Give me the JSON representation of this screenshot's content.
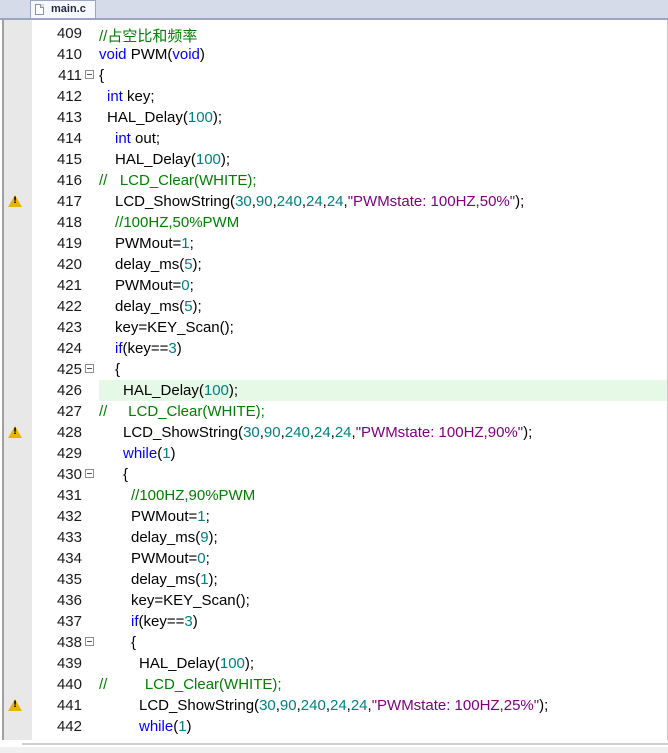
{
  "tab": {
    "label": "main.c",
    "icon": "c-file-icon"
  },
  "lines": [
    {
      "n": "409",
      "indent": 0,
      "segs": [
        {
          "t": "//占空比和频率",
          "c": "cm"
        }
      ]
    },
    {
      "n": "410",
      "indent": 0,
      "segs": [
        {
          "t": "void",
          "c": "kw"
        },
        {
          "t": " PWM(",
          "c": ""
        },
        {
          "t": "void",
          "c": "kw"
        },
        {
          "t": ")",
          "c": ""
        }
      ]
    },
    {
      "n": "411",
      "indent": 0,
      "fold": true,
      "segs": [
        {
          "t": "{",
          "c": ""
        }
      ]
    },
    {
      "n": "412",
      "indent": 1,
      "segs": [
        {
          "t": "int",
          "c": "kw"
        },
        {
          "t": " key;",
          "c": ""
        }
      ]
    },
    {
      "n": "413",
      "indent": 1,
      "segs": [
        {
          "t": "HAL_Delay(",
          "c": ""
        },
        {
          "t": "100",
          "c": "num"
        },
        {
          "t": ");",
          "c": ""
        }
      ]
    },
    {
      "n": "414",
      "indent": 2,
      "segs": [
        {
          "t": "int",
          "c": "kw"
        },
        {
          "t": " out;",
          "c": ""
        }
      ]
    },
    {
      "n": "415",
      "indent": 2,
      "segs": [
        {
          "t": "HAL_Delay(",
          "c": ""
        },
        {
          "t": "100",
          "c": "num"
        },
        {
          "t": ");",
          "c": ""
        }
      ]
    },
    {
      "n": "416",
      "indent": 0,
      "segs": [
        {
          "t": "//   LCD_Clear(WHITE);",
          "c": "cm"
        }
      ]
    },
    {
      "n": "417",
      "indent": 2,
      "warn": true,
      "segs": [
        {
          "t": "LCD_ShowString(",
          "c": ""
        },
        {
          "t": "30",
          "c": "num"
        },
        {
          "t": ",",
          "c": ""
        },
        {
          "t": "90",
          "c": "num"
        },
        {
          "t": ",",
          "c": ""
        },
        {
          "t": "240",
          "c": "num"
        },
        {
          "t": ",",
          "c": ""
        },
        {
          "t": "24",
          "c": "num"
        },
        {
          "t": ",",
          "c": ""
        },
        {
          "t": "24",
          "c": "num"
        },
        {
          "t": ",",
          "c": ""
        },
        {
          "t": "\"PWMstate: 100HZ,50%\"",
          "c": "str"
        },
        {
          "t": ");",
          "c": ""
        }
      ]
    },
    {
      "n": "418",
      "indent": 2,
      "segs": [
        {
          "t": "//100HZ,50%PWM",
          "c": "cm"
        }
      ]
    },
    {
      "n": "419",
      "indent": 2,
      "segs": [
        {
          "t": "PWMout=",
          "c": ""
        },
        {
          "t": "1",
          "c": "num"
        },
        {
          "t": ";",
          "c": ""
        }
      ]
    },
    {
      "n": "420",
      "indent": 2,
      "segs": [
        {
          "t": "delay_ms(",
          "c": ""
        },
        {
          "t": "5",
          "c": "num"
        },
        {
          "t": ");",
          "c": ""
        }
      ]
    },
    {
      "n": "421",
      "indent": 2,
      "segs": [
        {
          "t": "PWMout=",
          "c": ""
        },
        {
          "t": "0",
          "c": "num"
        },
        {
          "t": ";",
          "c": ""
        }
      ]
    },
    {
      "n": "422",
      "indent": 2,
      "segs": [
        {
          "t": "delay_ms(",
          "c": ""
        },
        {
          "t": "5",
          "c": "num"
        },
        {
          "t": ");",
          "c": ""
        }
      ]
    },
    {
      "n": "423",
      "indent": 2,
      "segs": [
        {
          "t": "key=KEY_Scan();",
          "c": ""
        }
      ]
    },
    {
      "n": "424",
      "indent": 2,
      "segs": [
        {
          "t": "if",
          "c": "kw"
        },
        {
          "t": "(key==",
          "c": ""
        },
        {
          "t": "3",
          "c": "num"
        },
        {
          "t": ")",
          "c": ""
        }
      ]
    },
    {
      "n": "425",
      "indent": 2,
      "fold": true,
      "segs": [
        {
          "t": "{",
          "c": ""
        }
      ]
    },
    {
      "n": "426",
      "indent": 3,
      "hl": true,
      "segs": [
        {
          "t": "HAL_Delay(",
          "c": ""
        },
        {
          "t": "100",
          "c": "num"
        },
        {
          "t": ");",
          "c": ""
        }
      ]
    },
    {
      "n": "427",
      "indent": 0,
      "segs": [
        {
          "t": "//     LCD_Clear(WHITE);",
          "c": "cm"
        }
      ]
    },
    {
      "n": "428",
      "indent": 3,
      "warn": true,
      "segs": [
        {
          "t": "LCD_ShowString(",
          "c": ""
        },
        {
          "t": "30",
          "c": "num"
        },
        {
          "t": ",",
          "c": ""
        },
        {
          "t": "90",
          "c": "num"
        },
        {
          "t": ",",
          "c": ""
        },
        {
          "t": "240",
          "c": "num"
        },
        {
          "t": ",",
          "c": ""
        },
        {
          "t": "24",
          "c": "num"
        },
        {
          "t": ",",
          "c": ""
        },
        {
          "t": "24",
          "c": "num"
        },
        {
          "t": ",",
          "c": ""
        },
        {
          "t": "\"PWMstate: 100HZ,90%\"",
          "c": "str"
        },
        {
          "t": ");",
          "c": ""
        }
      ]
    },
    {
      "n": "429",
      "indent": 3,
      "segs": [
        {
          "t": "while",
          "c": "kw"
        },
        {
          "t": "(",
          "c": ""
        },
        {
          "t": "1",
          "c": "num"
        },
        {
          "t": ")",
          "c": ""
        }
      ]
    },
    {
      "n": "430",
      "indent": 3,
      "fold": true,
      "segs": [
        {
          "t": "{",
          "c": ""
        }
      ]
    },
    {
      "n": "431",
      "indent": 4,
      "segs": [
        {
          "t": "//100HZ,90%PWM",
          "c": "cm"
        }
      ]
    },
    {
      "n": "432",
      "indent": 4,
      "segs": [
        {
          "t": "PWMout=",
          "c": ""
        },
        {
          "t": "1",
          "c": "num"
        },
        {
          "t": ";",
          "c": ""
        }
      ]
    },
    {
      "n": "433",
      "indent": 4,
      "segs": [
        {
          "t": "delay_ms(",
          "c": ""
        },
        {
          "t": "9",
          "c": "num"
        },
        {
          "t": ");",
          "c": ""
        }
      ]
    },
    {
      "n": "434",
      "indent": 4,
      "segs": [
        {
          "t": "PWMout=",
          "c": ""
        },
        {
          "t": "0",
          "c": "num"
        },
        {
          "t": ";",
          "c": ""
        }
      ]
    },
    {
      "n": "435",
      "indent": 4,
      "segs": [
        {
          "t": "delay_ms(",
          "c": ""
        },
        {
          "t": "1",
          "c": "num"
        },
        {
          "t": ");",
          "c": ""
        }
      ]
    },
    {
      "n": "436",
      "indent": 4,
      "segs": [
        {
          "t": "key=KEY_Scan();",
          "c": ""
        }
      ]
    },
    {
      "n": "437",
      "indent": 4,
      "segs": [
        {
          "t": "if",
          "c": "kw"
        },
        {
          "t": "(key==",
          "c": ""
        },
        {
          "t": "3",
          "c": "num"
        },
        {
          "t": ")",
          "c": ""
        }
      ]
    },
    {
      "n": "438",
      "indent": 4,
      "fold": true,
      "segs": [
        {
          "t": "{",
          "c": ""
        }
      ]
    },
    {
      "n": "439",
      "indent": 5,
      "segs": [
        {
          "t": "HAL_Delay(",
          "c": ""
        },
        {
          "t": "100",
          "c": "num"
        },
        {
          "t": ");",
          "c": ""
        }
      ]
    },
    {
      "n": "440",
      "indent": 0,
      "segs": [
        {
          "t": "//         LCD_Clear(WHITE);",
          "c": "cm"
        }
      ]
    },
    {
      "n": "441",
      "indent": 5,
      "warn": true,
      "segs": [
        {
          "t": "LCD_ShowString(",
          "c": ""
        },
        {
          "t": "30",
          "c": "num"
        },
        {
          "t": ",",
          "c": ""
        },
        {
          "t": "90",
          "c": "num"
        },
        {
          "t": ",",
          "c": ""
        },
        {
          "t": "240",
          "c": "num"
        },
        {
          "t": ",",
          "c": ""
        },
        {
          "t": "24",
          "c": "num"
        },
        {
          "t": ",",
          "c": ""
        },
        {
          "t": "24",
          "c": "num"
        },
        {
          "t": ",",
          "c": ""
        },
        {
          "t": "\"PWMstate: 100HZ,25%\"",
          "c": "str"
        },
        {
          "t": ");",
          "c": ""
        }
      ]
    },
    {
      "n": "442",
      "indent": 5,
      "segs": [
        {
          "t": "while",
          "c": "kw"
        },
        {
          "t": "(",
          "c": ""
        },
        {
          "t": "1",
          "c": "num"
        },
        {
          "t": ")",
          "c": ""
        }
      ]
    }
  ]
}
